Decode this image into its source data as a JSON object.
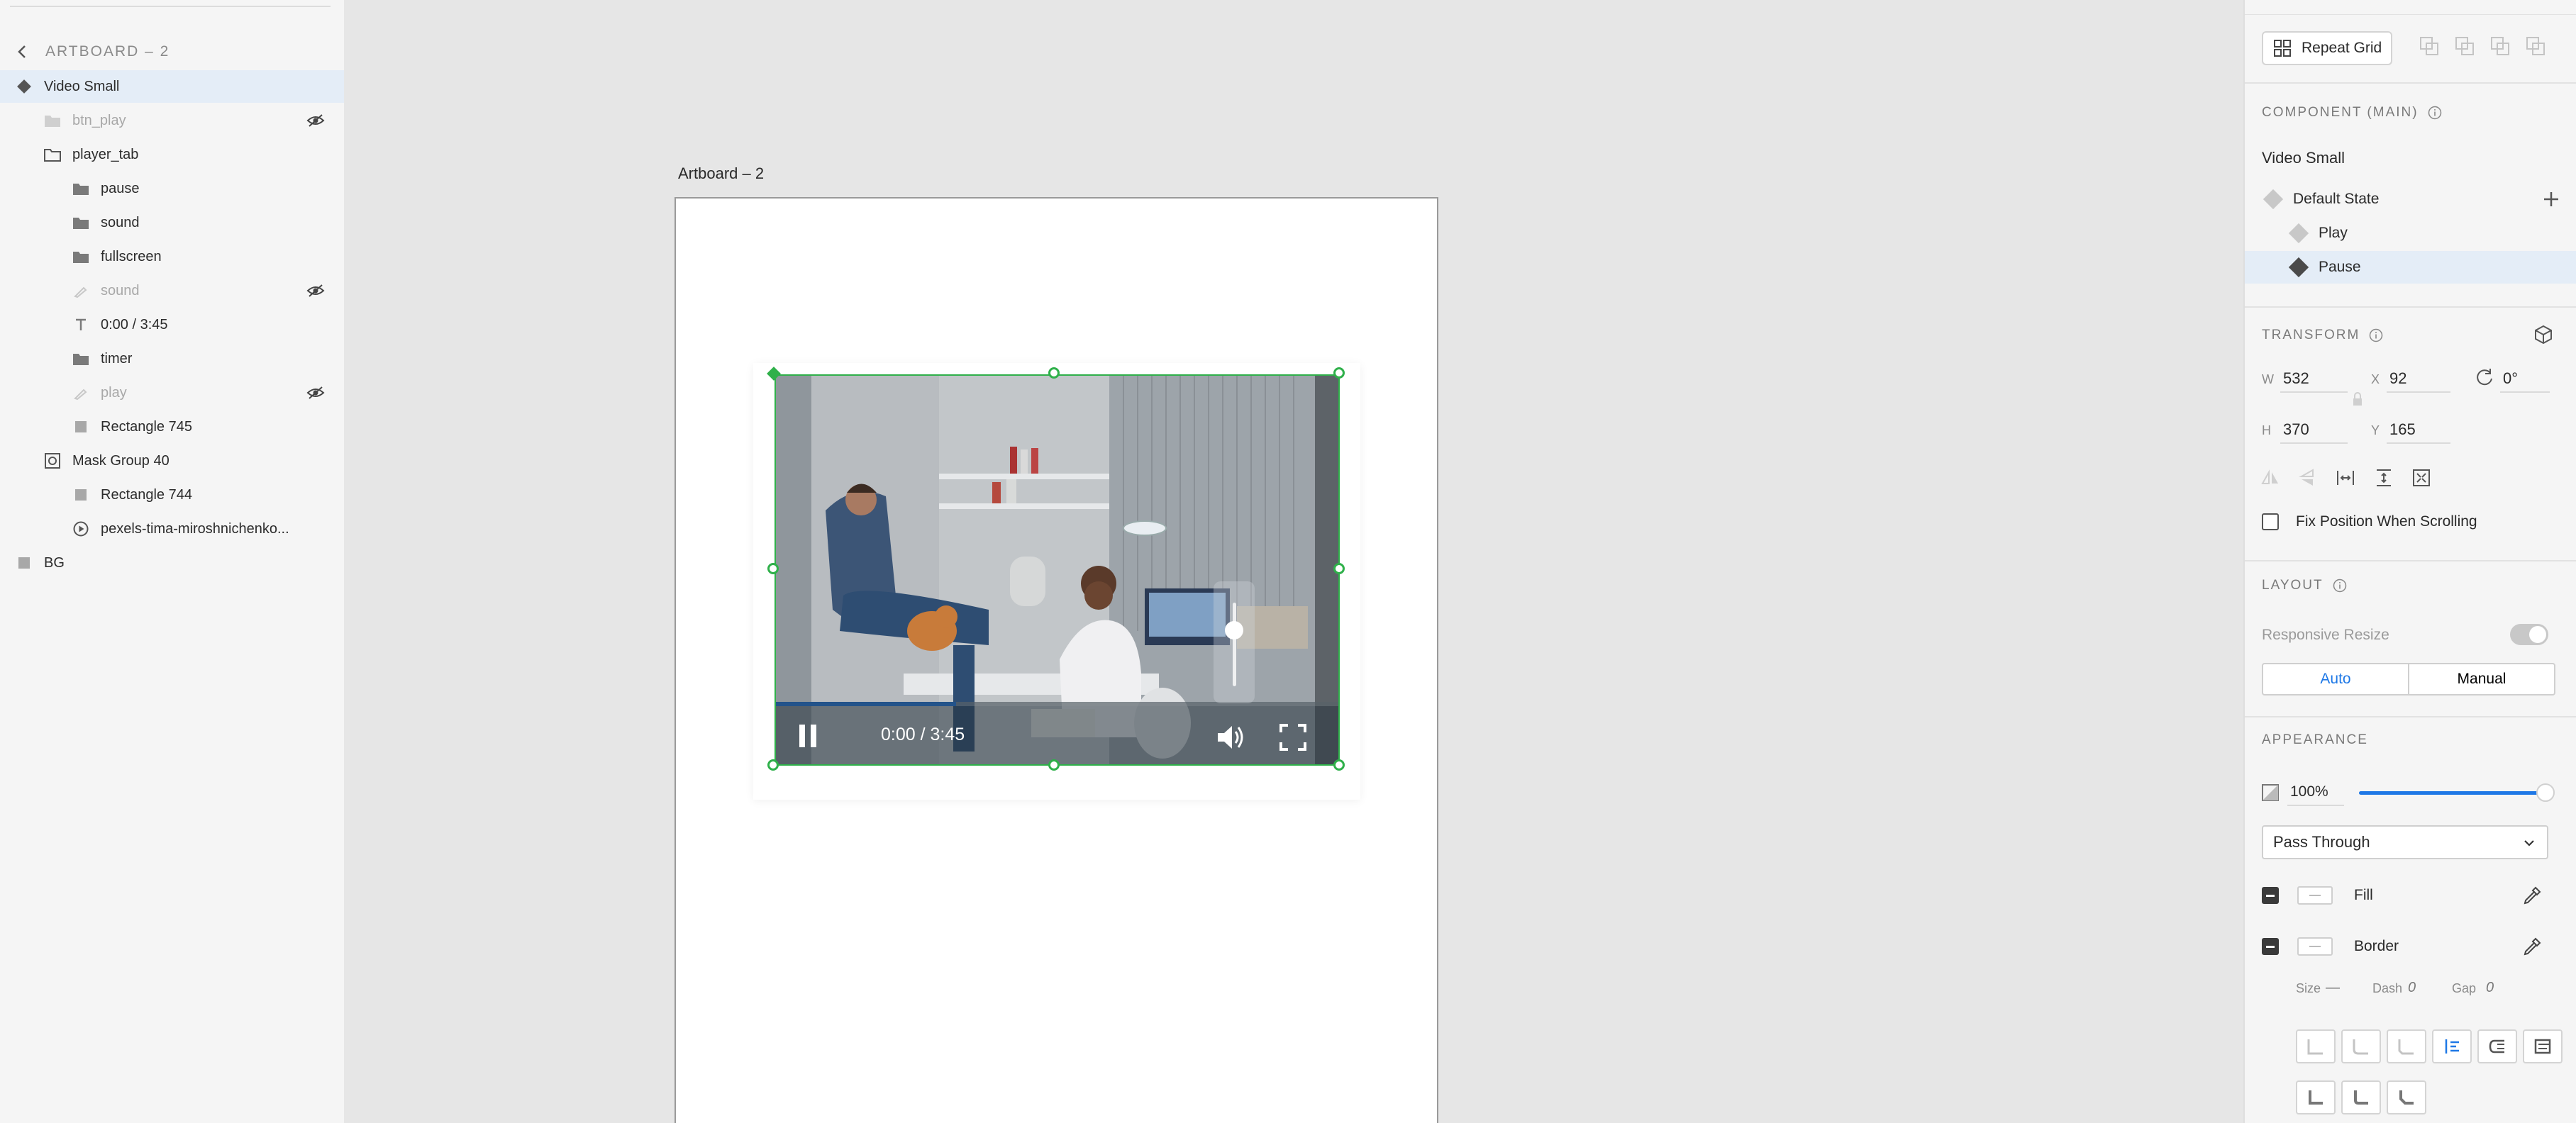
{
  "layers_panel": {
    "breadcrumb": "ARTBOARD – 2",
    "layers": [
      {
        "label": "Video Small",
        "icon": "component-icon",
        "selected": true
      },
      {
        "label": "btn_play",
        "icon": "folder-icon",
        "hidden": true
      },
      {
        "label": "player_tab",
        "icon": "folder-open-icon"
      },
      {
        "label": "pause",
        "icon": "folder-icon"
      },
      {
        "label": "sound",
        "icon": "folder-icon"
      },
      {
        "label": "fullscreen",
        "icon": "folder-icon"
      },
      {
        "label": "sound",
        "icon": "pen-icon",
        "hidden": true
      },
      {
        "label": "0:00 / 3:45",
        "icon": "text-icon"
      },
      {
        "label": "timer",
        "icon": "folder-icon"
      },
      {
        "label": "play",
        "icon": "pen-icon",
        "hidden": true
      },
      {
        "label": "Rectangle 745",
        "icon": "rectangle-icon"
      },
      {
        "label": "Mask Group 40",
        "icon": "mask-group-icon"
      },
      {
        "label": "Rectangle 744",
        "icon": "rectangle-icon"
      },
      {
        "label": "pexels-tima-miroshnichenko...",
        "icon": "video-icon"
      },
      {
        "label": "BG",
        "icon": "rectangle-icon"
      }
    ]
  },
  "canvas": {
    "artboard_label": "Artboard – 2",
    "video": {
      "time": "0:00 / 3:45",
      "progress": 0.32,
      "volume": 0.67
    }
  },
  "properties": {
    "repeat_grid_label": "Repeat Grid",
    "component_header": "COMPONENT (MAIN)",
    "component_name": "Video Small",
    "states": [
      {
        "label": "Default State",
        "selected": false
      },
      {
        "label": "Play",
        "selected": false
      },
      {
        "label": "Pause",
        "selected": true
      }
    ],
    "transform_header": "TRANSFORM",
    "transform": {
      "w_label": "W",
      "w": "532",
      "x_label": "X",
      "x": "92",
      "h_label": "H",
      "h": "370",
      "y_label": "Y",
      "y": "165",
      "rotation": "0°"
    },
    "fix_position_label": "Fix Position When Scrolling",
    "layout_header": "LAYOUT",
    "responsive_resize_label": "Responsive Resize",
    "layout_tabs": [
      "Auto",
      "Manual"
    ],
    "appearance_header": "APPEARANCE",
    "opacity": "100%",
    "blend_mode": "Pass Through",
    "fill_label": "Fill",
    "border_label": "Border",
    "stroke": {
      "size_label": "Size",
      "size": "—",
      "dash_label": "Dash",
      "dash": "0",
      "gap_label": "Gap",
      "gap": "0"
    }
  },
  "colors": {
    "accent": "#1e78e6",
    "selection": "#2fb04a",
    "panel": "#f5f5f5",
    "canvas": "#e6e6e6"
  }
}
